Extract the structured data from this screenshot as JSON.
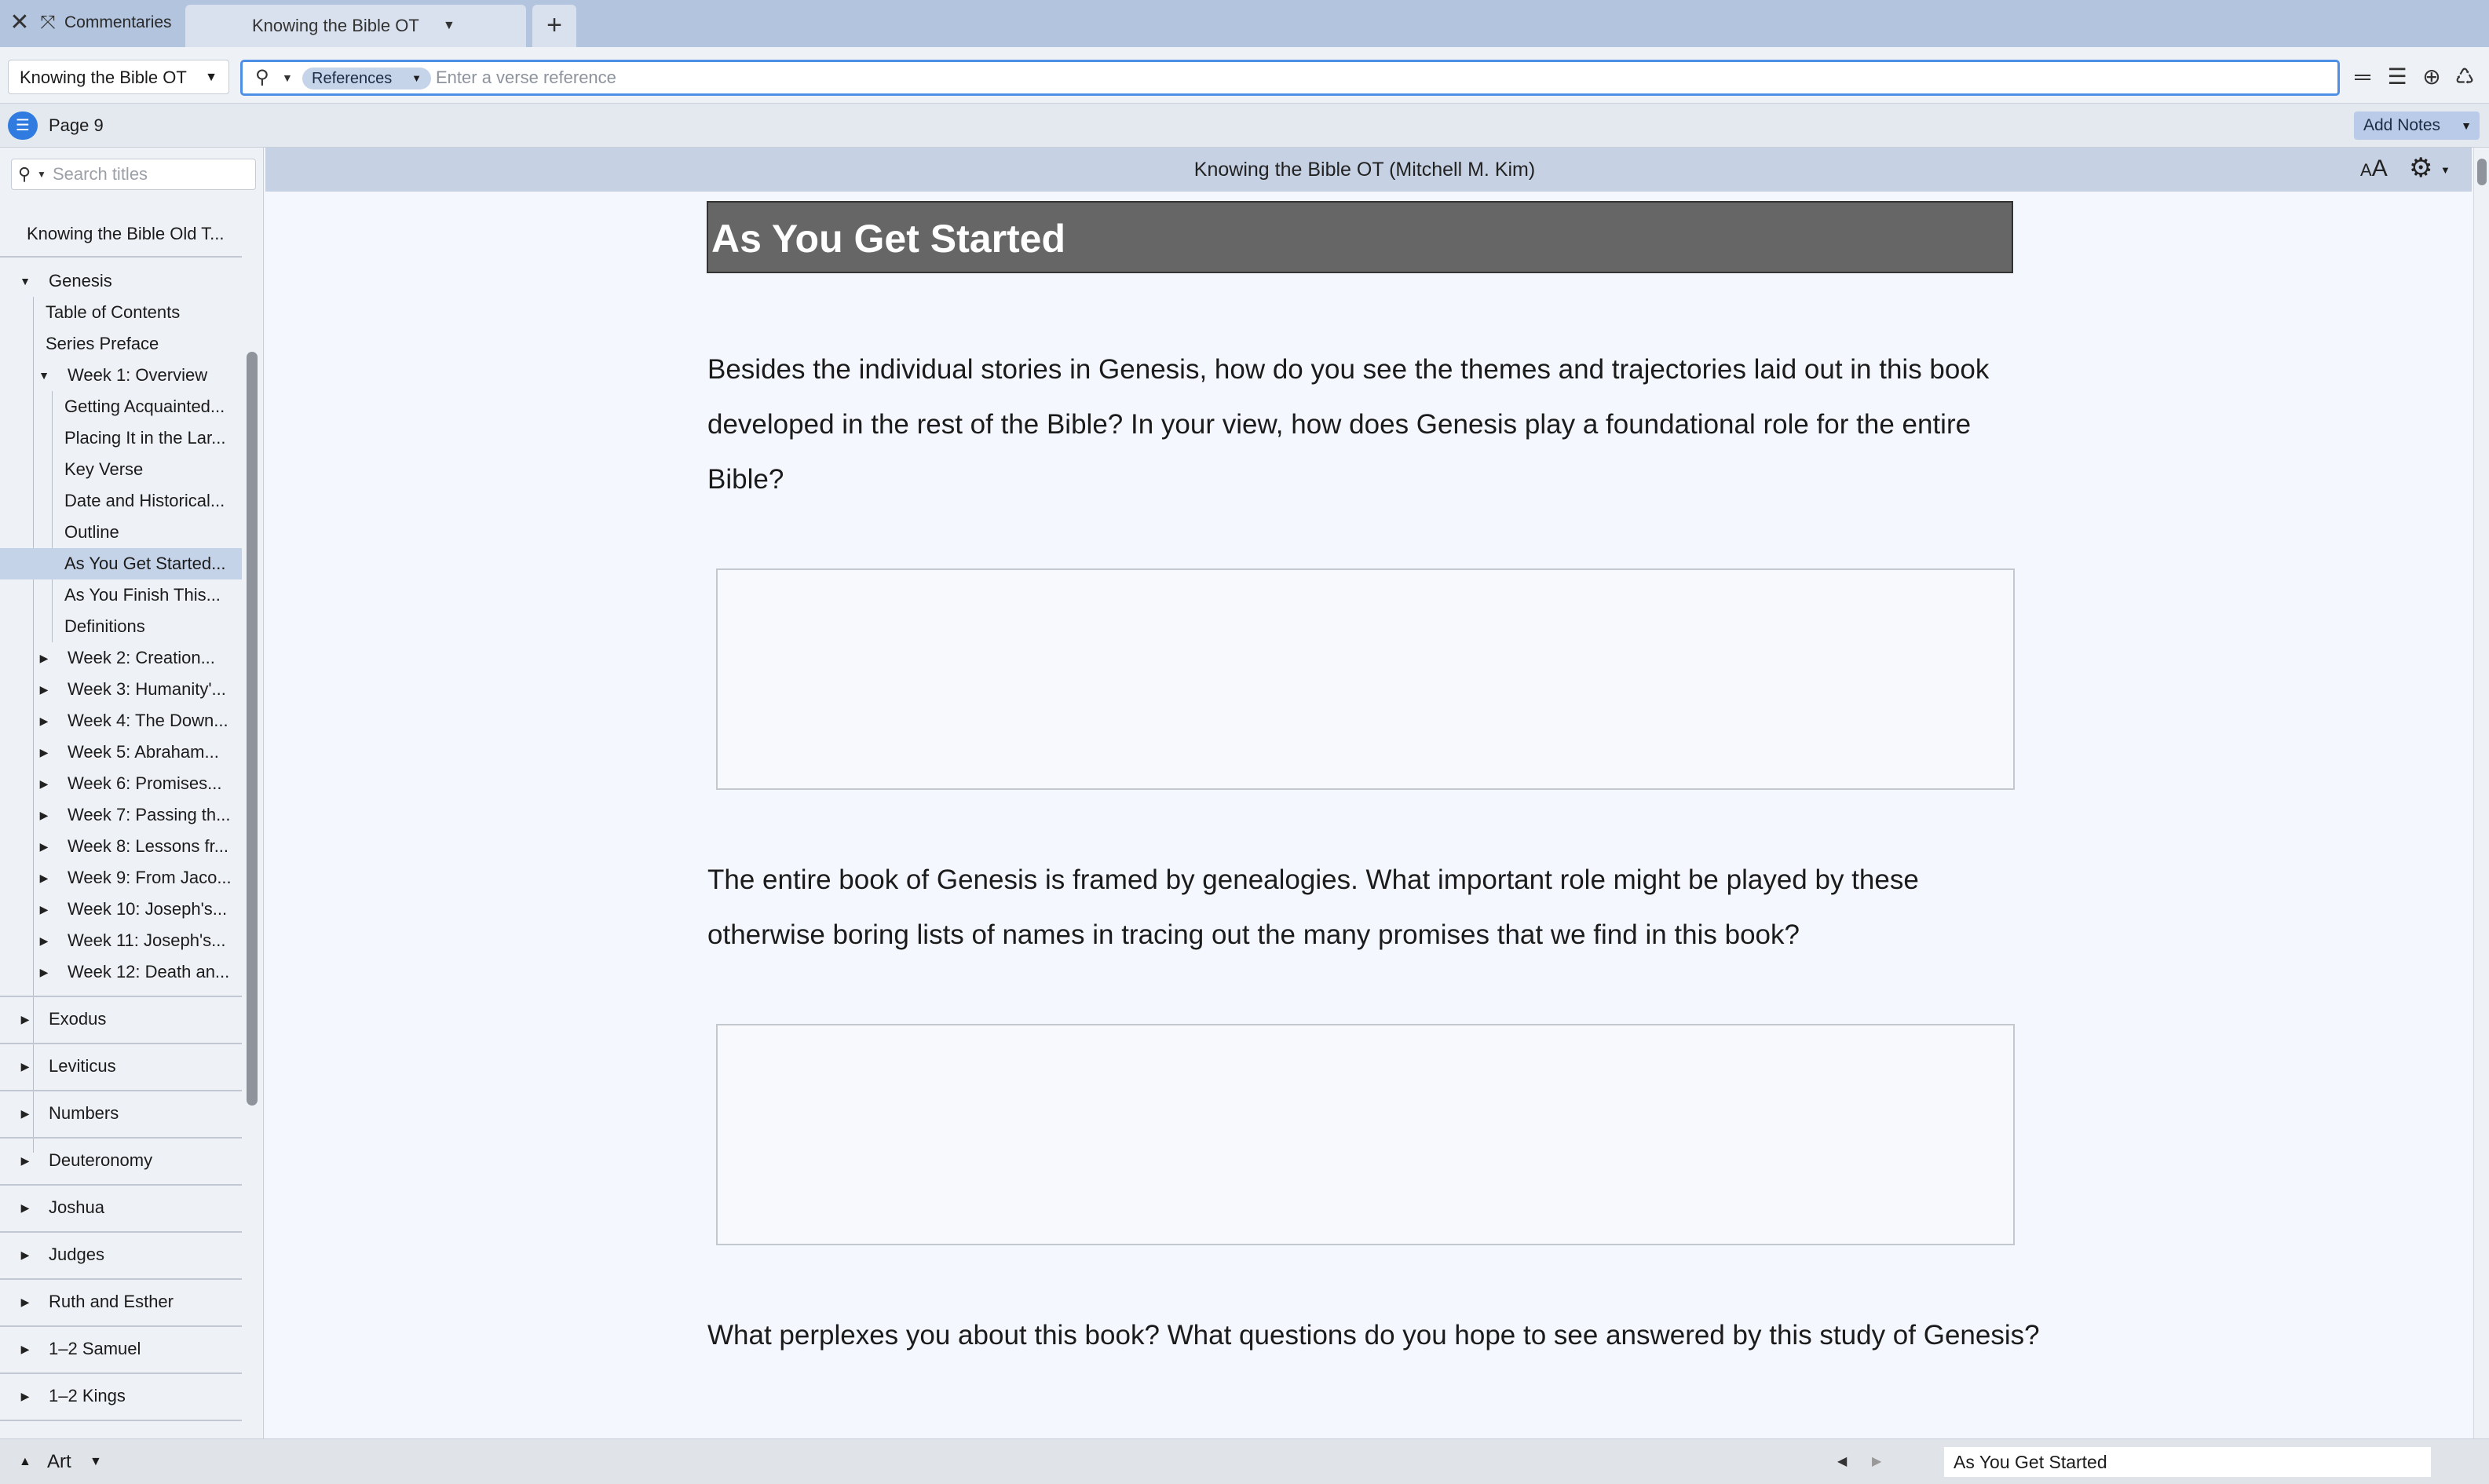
{
  "tabbar": {
    "close_glyph": "✕",
    "fit_glyph": "⤧",
    "panel_name": "Commentaries",
    "tab_label": "Knowing the Bible OT",
    "new_tab_glyph": "+"
  },
  "toolbar": {
    "resource": "Knowing the Bible OT",
    "search_mode": "References",
    "search_placeholder": "Enter a verse reference",
    "icons": {
      "parallel": "parallel-icon",
      "toc": "list-icon",
      "add": "plus-circle-icon",
      "share": "share-icon"
    }
  },
  "pagebar": {
    "page": "Page 9",
    "add_notes": "Add Notes"
  },
  "sidebar": {
    "search_placeholder": "Search titles",
    "root": "Knowing the Bible Old T...",
    "genesis": {
      "label": "Genesis",
      "children": [
        "Table of Contents",
        "Series Preface"
      ],
      "week1": {
        "label": "Week 1: Overview",
        "children": [
          "Getting Acquainted...",
          "Placing It in the Lar...",
          "Key Verse",
          "Date and Historical...",
          "Outline",
          "As You Get Started...",
          "As You Finish This...",
          "Definitions"
        ]
      },
      "weeks": [
        "Week 2: Creation...",
        "Week 3: Humanity'...",
        "Week 4: The Down...",
        "Week 5: Abraham...",
        "Week 6: Promises...",
        "Week 7: Passing th...",
        "Week 8: Lessons fr...",
        "Week 9: From Jaco...",
        "Week 10: Joseph's...",
        "Week 11: Joseph's...",
        "Week 12: Death an..."
      ]
    },
    "books": [
      "Exodus",
      "Leviticus",
      "Numbers",
      "Deuteronomy",
      "Joshua",
      "Judges",
      "Ruth and Esther",
      "1–2 Samuel",
      "1–2 Kings"
    ],
    "selected": "As You Get Started..."
  },
  "content": {
    "header_title": "Knowing the Bible OT (Mitchell M. Kim)",
    "section_title": "As You Get Started",
    "questions": [
      "Besides the individual stories in Genesis, how do you see the themes and trajectories laid out in this book developed in the rest of the Bible? In your view, how does Genesis play a foundational role for the entire Bible?",
      "The entire book of Genesis is framed by genealogies. What important role might be played by these otherwise boring lists of names in tracing out the many promises that we find in this book?",
      "What perplexes you about this book? What questions do you hope to see answered by this study of Genesis?"
    ]
  },
  "statusbar": {
    "panel_menu": "Art",
    "location": "As You Get Started"
  },
  "colors": {
    "tabbar": "#b2c4de",
    "accent": "#2f7be0",
    "selected_row": "#c5d3e9",
    "section_title_bg": "#666666"
  }
}
